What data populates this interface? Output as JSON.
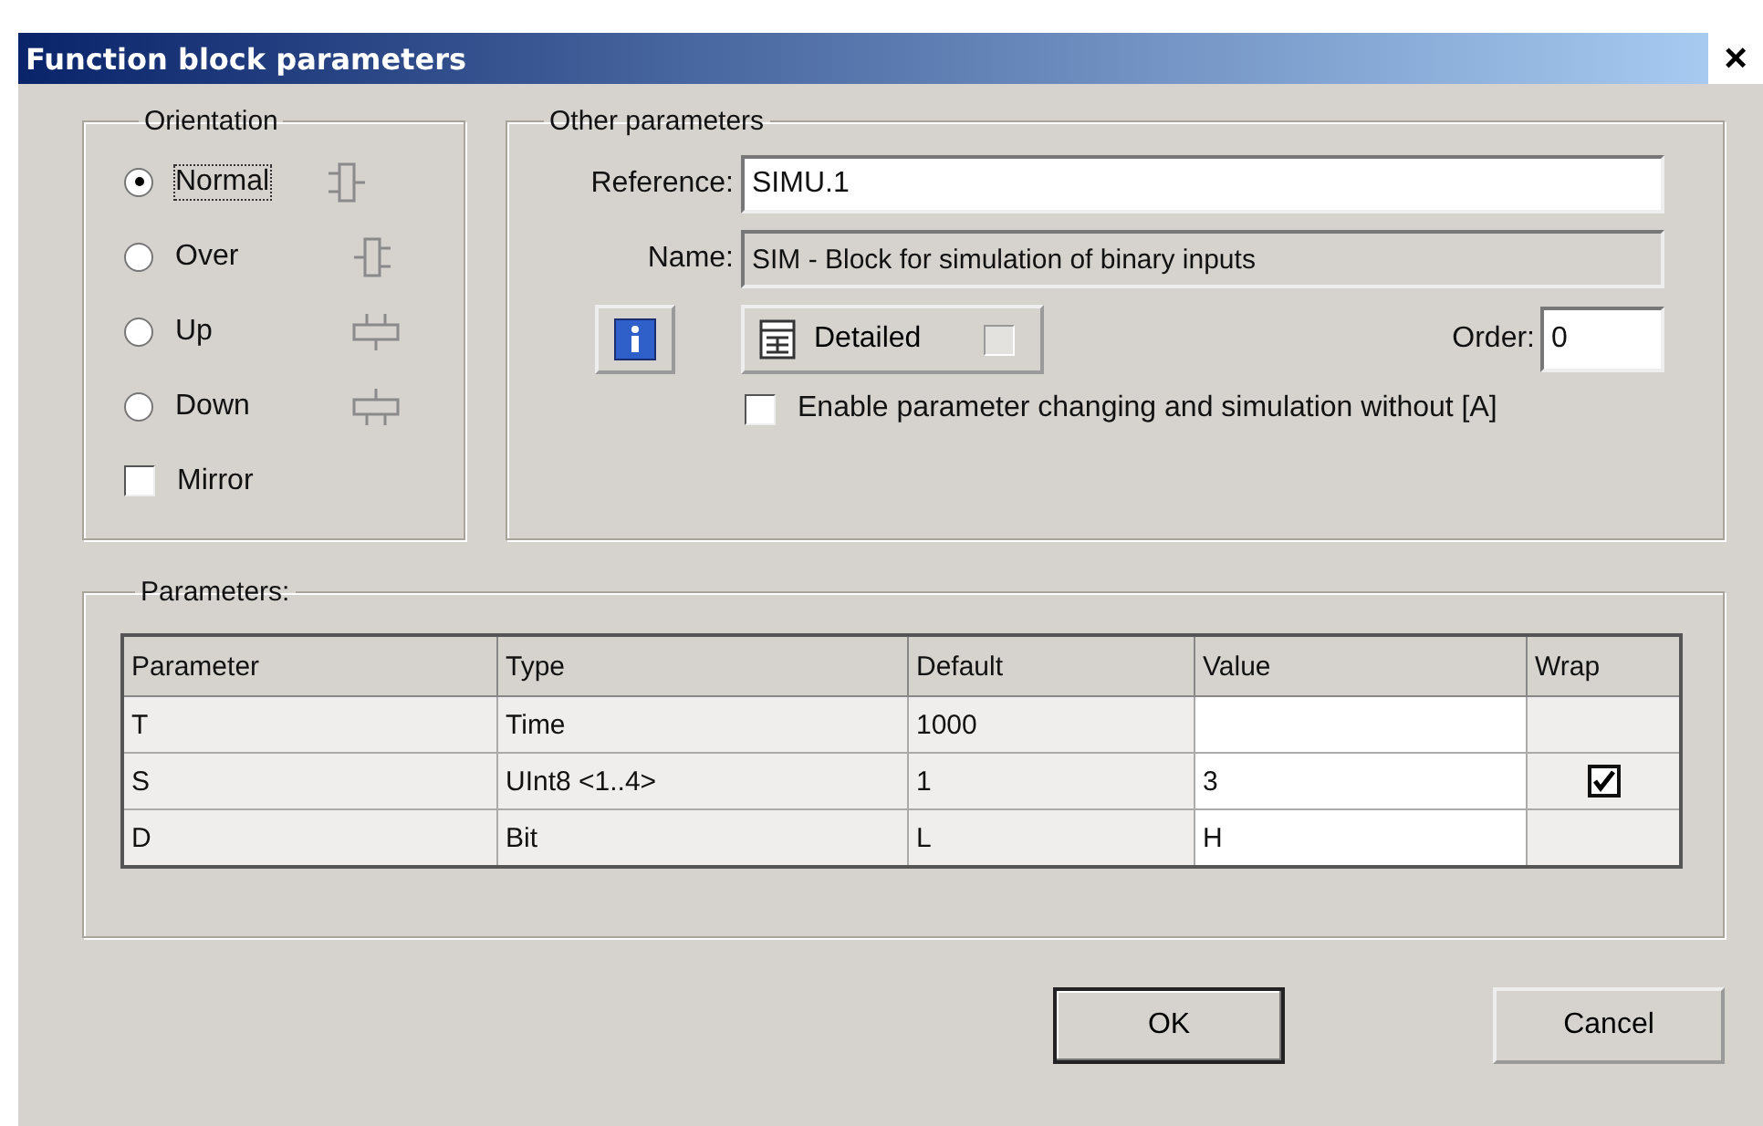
{
  "window": {
    "title": "Function block parameters",
    "close": "×"
  },
  "orientation": {
    "title": "Orientation",
    "options": [
      {
        "label": "Normal",
        "selected": true
      },
      {
        "label": "Over",
        "selected": false
      },
      {
        "label": "Up",
        "selected": false
      },
      {
        "label": "Down",
        "selected": false
      }
    ],
    "mirror": {
      "label": "Mirror",
      "checked": false
    }
  },
  "other_parameters": {
    "title": "Other parameters",
    "reference": {
      "label": "Reference:",
      "value": "SIMU.1"
    },
    "name": {
      "label": "Name:",
      "value": "SIM - Block for simulation of binary inputs",
      "disabled": true
    },
    "detailed": {
      "label": "Detailed",
      "checked": false
    },
    "order": {
      "label": "Order:",
      "value": "0"
    },
    "enable": {
      "label": "Enable parameter changing and simulation without [A]",
      "checked": false
    }
  },
  "parameters": {
    "title": "Parameters:",
    "columns": [
      "Parameter",
      "Type",
      "Default",
      "Value",
      "Wrap"
    ],
    "rows": [
      {
        "cells": [
          "T",
          "Time",
          "1000",
          ""
        ]
      },
      {
        "cells": [
          "S",
          "UInt8 <1..4>",
          "1",
          "3"
        ],
        "wrap": {
          "checked": true
        }
      },
      {
        "cells": [
          "D",
          "Bit",
          "L",
          "H"
        ]
      }
    ]
  },
  "buttons": [
    {
      "label": "OK",
      "default": true
    },
    {
      "label": "Cancel",
      "default": false
    }
  ]
}
